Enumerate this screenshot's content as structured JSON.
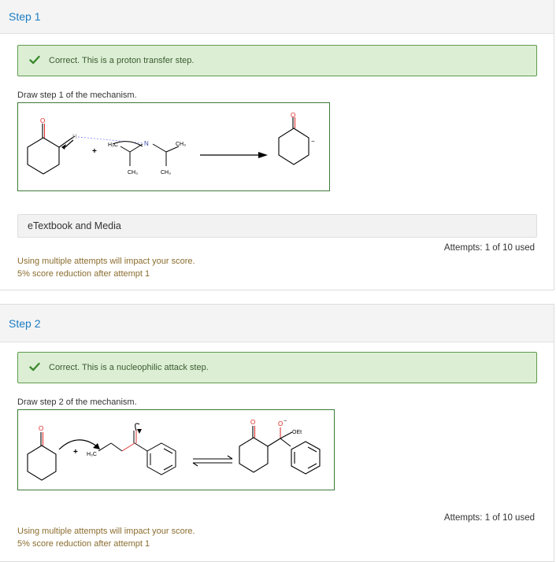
{
  "steps": [
    {
      "title": "Step 1",
      "alert": "Correct. This is a proton transfer step.",
      "prompt": "Draw step 1 of the mechanism.",
      "media": "eTextbook and Media",
      "attempts": "Attempts: 1 of 10 used",
      "note1": "Using multiple attempts will impact your score.",
      "note2": "5% score reduction after attempt 1"
    },
    {
      "title": "Step 2",
      "alert": "Correct. This is a nucleophilic attack step.",
      "prompt": "Draw step 2 of the mechanism.",
      "attempts": "Attempts: 1 of 10 used",
      "note1": "Using multiple attempts will impact your score.",
      "note2": "5% score reduction after attempt 1"
    }
  ],
  "molecule_labels": {
    "O": "O",
    "H": "H",
    "plus": "+",
    "N": "N",
    "H3C": "H₃C",
    "CH3": "CH₃",
    "minus": "−",
    "OEt": "OEt"
  },
  "colors": {
    "accent": "#1a7cc4",
    "success_bg": "#dcefd4",
    "success_border": "#5f9a4d",
    "note": "#8b6d2f"
  }
}
